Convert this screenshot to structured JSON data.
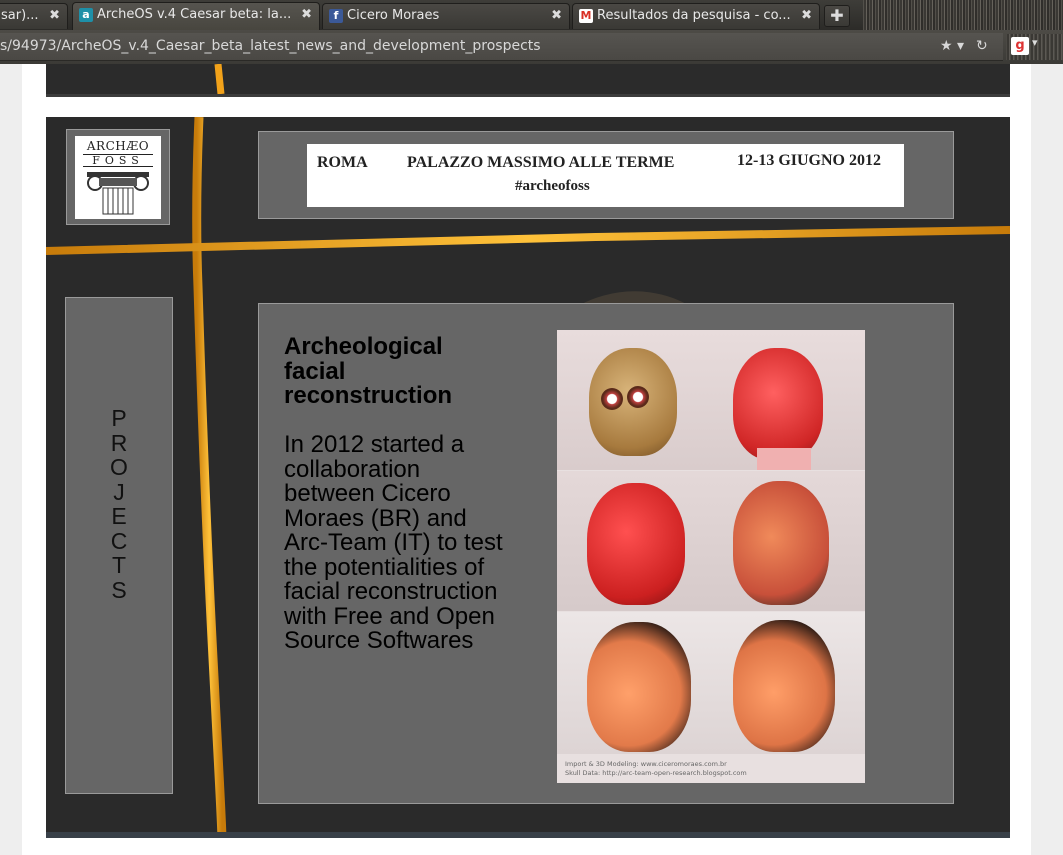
{
  "browser": {
    "tabs": [
      {
        "label": "sar)...",
        "favicon": "",
        "close": "✖",
        "active": false
      },
      {
        "label": "ArcheOS v.4 Caesar beta: la...",
        "favicon": "a",
        "close": "✖",
        "active": true
      },
      {
        "label": "Cicero Moraes",
        "favicon": "f",
        "close": "✖",
        "active": false
      },
      {
        "label": "Resultados da pesquisa - co...",
        "favicon": "M",
        "close": "✖",
        "active": false
      }
    ],
    "new_tab_label": "✚",
    "url": "s/94973/ArcheOS_v.4_Caesar_beta_latest_news_and_development_prospects",
    "bookmark_star": "★ ▾",
    "reload": "↻",
    "google_icon": "g",
    "google_dropdown": "▾",
    "colors": {
      "tabbar": "#3b3a36",
      "accent": "#f5a623"
    }
  },
  "page": {
    "logo": {
      "line1": "ARCHÆO",
      "line2": "FOSS"
    },
    "banner": {
      "city": "ROMA",
      "place": "PALAZZO MASSIMO ALLE TERME",
      "date": "12-13 GIUGNO 2012",
      "hashtag": "#archeofoss"
    },
    "sidebar_label": "PROJECTS",
    "article": {
      "title": "Archeological facial reconstruction",
      "body": "In 2012 started a collaboration between Cicero Moraes (BR) and Arc-Team (IT) to test the potentialities of facial reconstruction with Free and Open Source Softwares"
    },
    "image": {
      "credit_line1": "Import & 3D Modeling: www.ciceromoraes.com.br",
      "credit_line2": "Skull Data: http://arc-team-open-research.blogspot.com"
    }
  }
}
